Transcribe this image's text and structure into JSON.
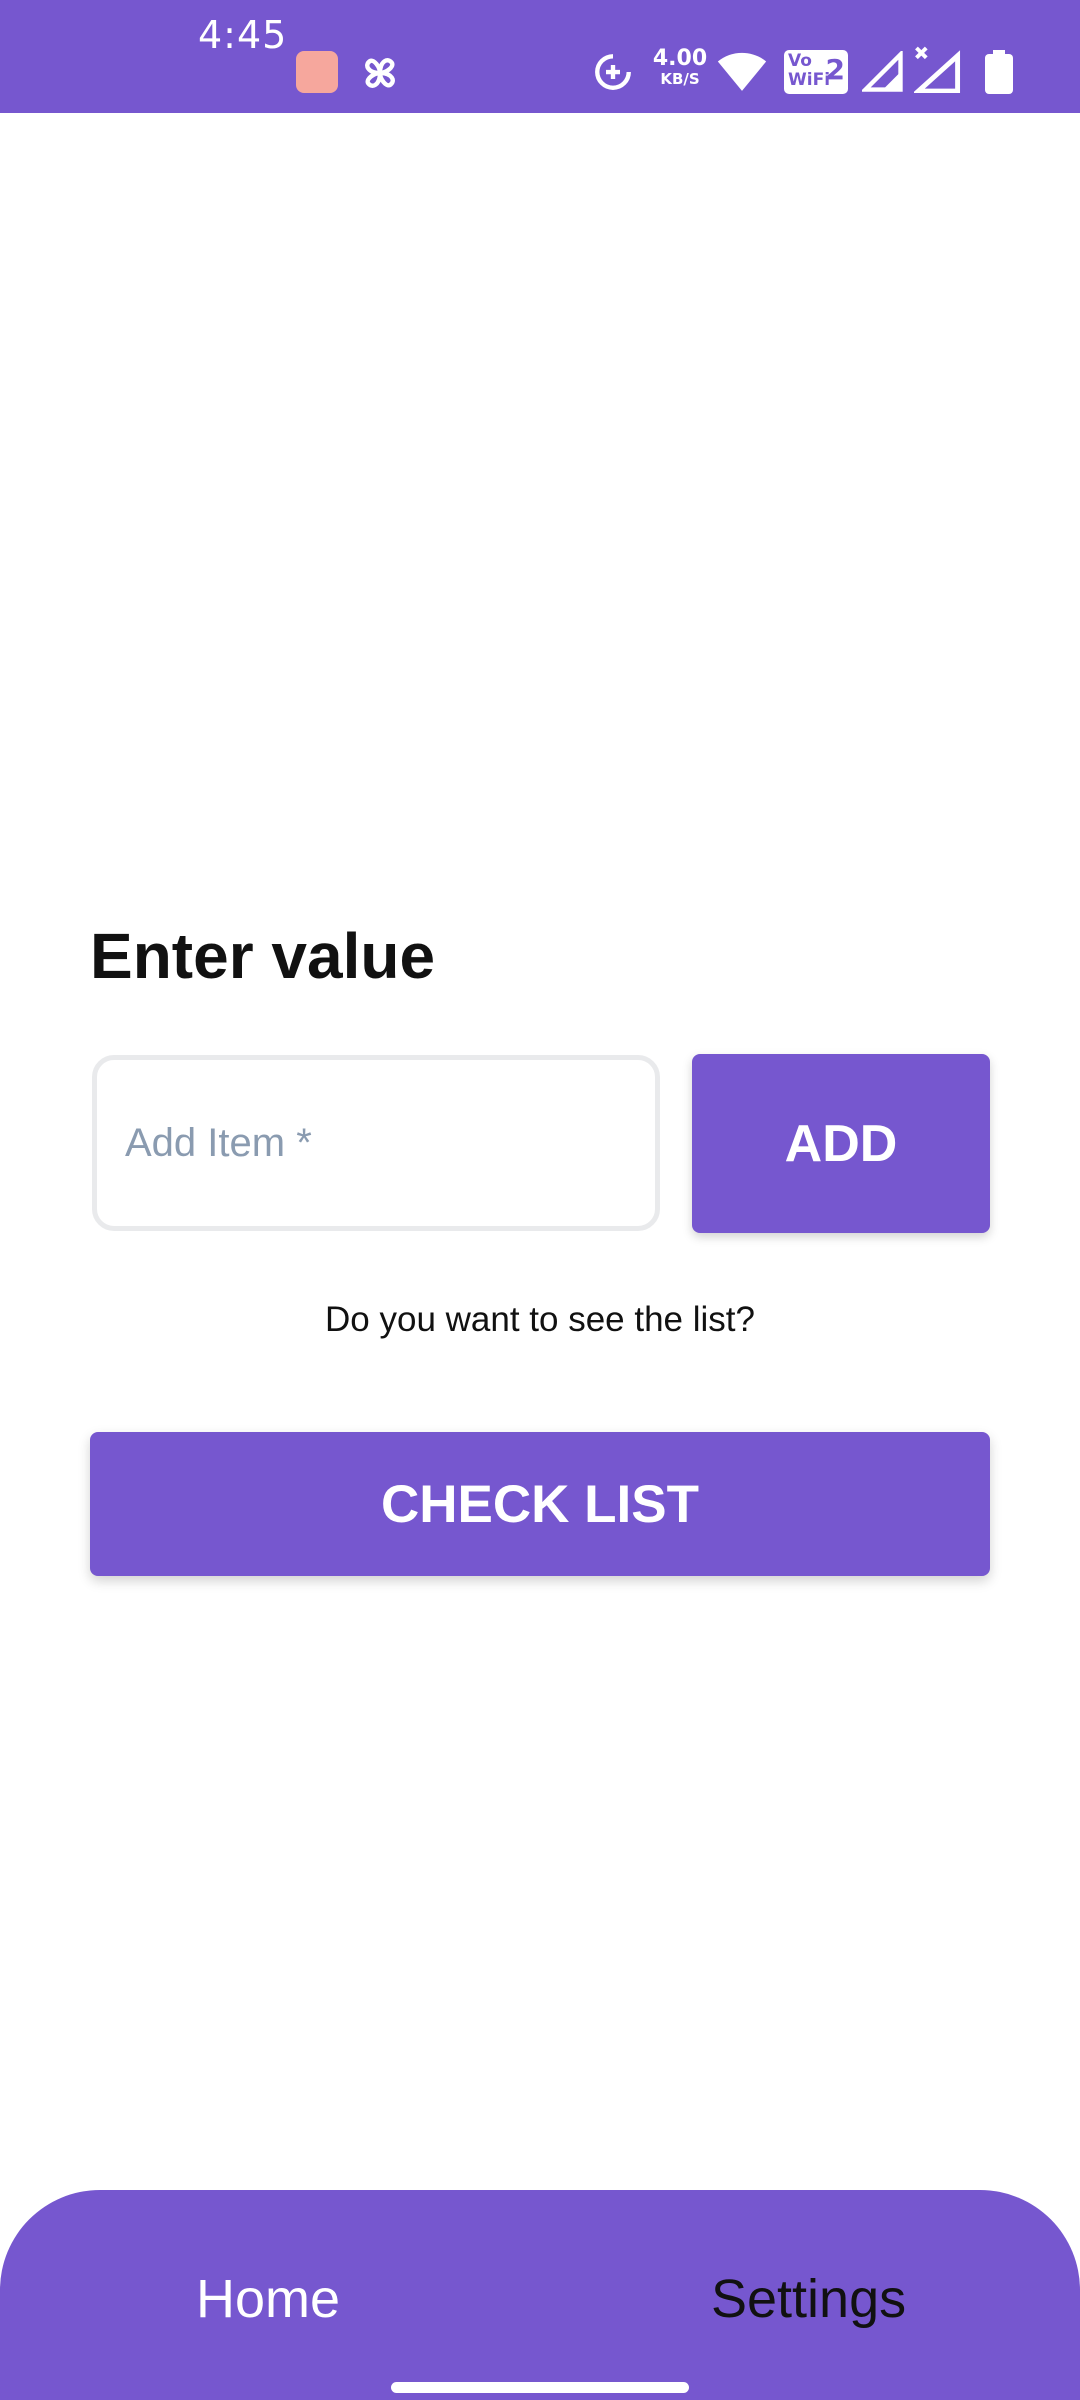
{
  "status_bar": {
    "time": "4:45",
    "network_speed_value": "4.00",
    "network_speed_unit": "KB/S",
    "vowifi_line1": "Vo",
    "vowifi_line2": "WiFi",
    "vowifi_sim": "2",
    "icons": [
      "app-notification-icon",
      "pinwheel-icon",
      "data-saver-icon",
      "wifi-icon",
      "vowifi-icon",
      "signal-icon",
      "signal-no-data-icon",
      "battery-icon"
    ]
  },
  "form": {
    "heading": "Enter value",
    "input_placeholder": "Add Item *",
    "input_value": "",
    "add_label": "ADD",
    "prompt": "Do you want to see the list?",
    "check_list_label": "CHECK LIST"
  },
  "bottom_nav": {
    "home_label": "Home",
    "settings_label": "Settings"
  },
  "colors": {
    "accent": "#7657CF",
    "placeholder": "#8A9BB0",
    "input_border": "#E9EAEC",
    "app_icon": "#F6A79D"
  }
}
